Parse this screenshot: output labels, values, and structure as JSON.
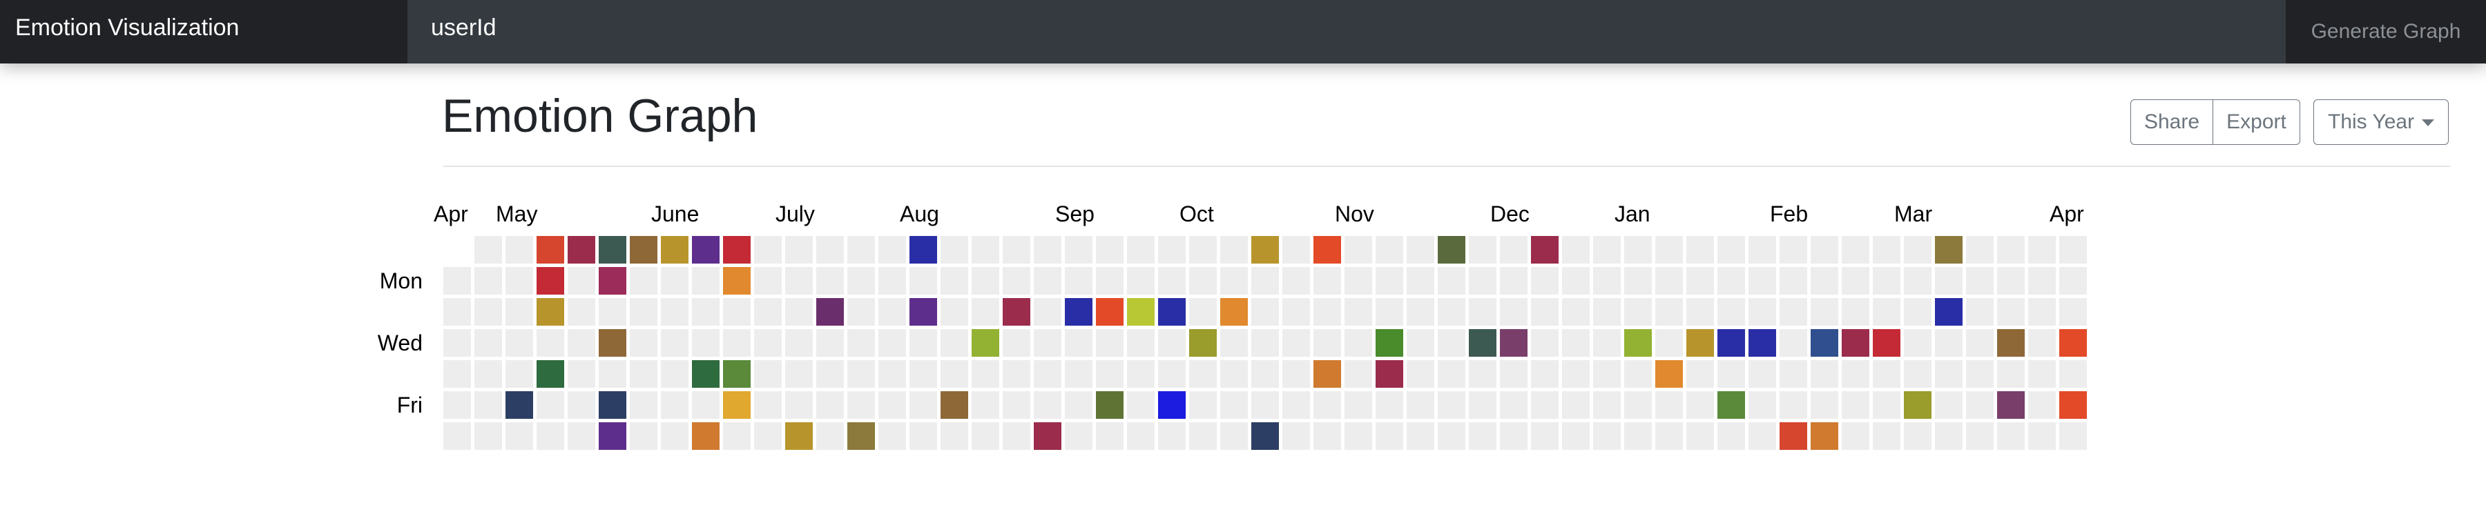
{
  "navbar": {
    "brand": "Emotion Visualization",
    "search_placeholder": "userId",
    "generate_button": "Generate Graph"
  },
  "page_title": "Emotion Graph",
  "toolbar": {
    "share_label": "Share",
    "export_label": "Export",
    "range_label": "This Year"
  },
  "graph": {
    "months": [
      {
        "label": "Apr",
        "week": 0
      },
      {
        "label": "May",
        "week": 2
      },
      {
        "label": "June",
        "week": 7
      },
      {
        "label": "July",
        "week": 11
      },
      {
        "label": "Aug",
        "week": 15
      },
      {
        "label": "Sep",
        "week": 20
      },
      {
        "label": "Oct",
        "week": 24
      },
      {
        "label": "Nov",
        "week": 29
      },
      {
        "label": "Dec",
        "week": 34
      },
      {
        "label": "Jan",
        "week": 38
      },
      {
        "label": "Feb",
        "week": 43
      },
      {
        "label": "Mar",
        "week": 47
      },
      {
        "label": "Apr",
        "week": 52
      }
    ],
    "day_labels": [
      {
        "label": "Mon",
        "row": 1
      },
      {
        "label": "Wed",
        "row": 3
      },
      {
        "label": "Fri",
        "row": 5
      }
    ],
    "empty_color": "#ededed",
    "first_row": 1,
    "palette": {
      "a": "#b8952c",
      "b": "#8f6838",
      "c": "#5e2e8c",
      "d": "#7a9a30",
      "e": "#5f7434",
      "f": "#3d5a52",
      "g": "#e34a27",
      "h": "#93b233",
      "i": "#4a8f2e",
      "j": "#2c3e63",
      "k": "#1e5a5a",
      "l": "#b87b2e",
      "m": "#d3a930",
      "n": "#6b2e6c",
      "o": "#5b2ea3",
      "p": "#9a9c2c",
      "q": "#9b2c4c",
      "r": "#e1892e",
      "s": "#9c2c5a",
      "t": "#1c35b8",
      "u": "#5b6a3c",
      "v": "#8e2e3c",
      "w": "#3a7a2e",
      "x": "#b8c835",
      "y": "#a34e32",
      "z": "#e0a82e",
      "A": "#2e6b3e",
      "B": "#2a2ea6",
      "C": "#e7d23c",
      "D": "#4a8b2c",
      "E": "#8c7a3c",
      "F": "#c42a35",
      "G": "#1c1ce0",
      "H": "#284f8a",
      "I": "#d6452e",
      "J": "#3e3a8c",
      "K": "#7a3e6a",
      "L": "#5a8a3a",
      "M": "#cf7a2f",
      "N": "#2f4f8f"
    },
    "weeks": [
      ".......",
      ".......",
      ".....j.",
      "IFaOA..",
      "q......",
      "fsSb.jc",
      "b...T..",
      "a.......",
      "c...A.M",
      "FrPOLz.",
      ".......",
      "......a",
      "..n.....",
      "......E",
      "..U.....",
      "B.c....",
      ".....b.",
      ".Y.h...",
      "..q...T",
      "......q",
      "..B.....",
      "..g..e.",
      "..x.....",
      "..B..G.",
      "...p...",
      "..r....",
      "a.....j",
      ".......",
      "g...M..",
      ".......",
      "...Dq..",
      ".......",
      "u......",
      "...f...",
      "...K...",
      "q......",
      ".......",
      "......",
      "...h...",
      "....r..",
      "...a...",
      "...B.L.",
      "...B...",
      "......I",
      "...N..M",
      "...q...",
      "...F...",
      ".....p.",
      "E.B....",
      ".......",
      "...b.K.",
      ".......",
      "...g.g."
    ]
  }
}
